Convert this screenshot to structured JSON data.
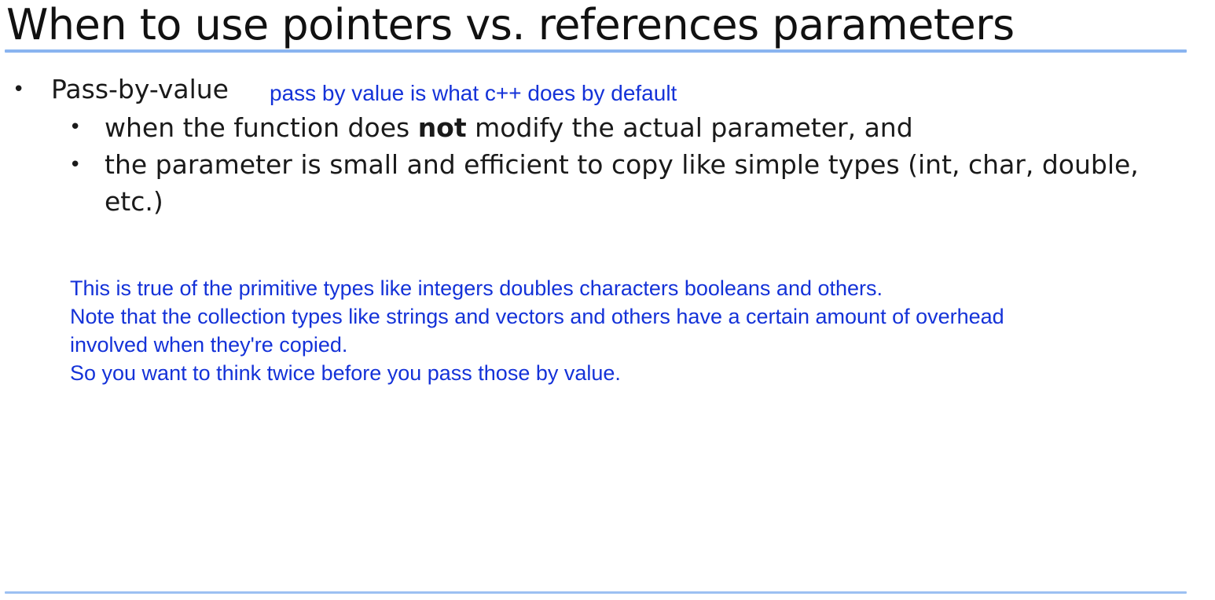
{
  "slide": {
    "title": "When to use pointers vs. references parameters"
  },
  "bullets": {
    "level1": {
      "marker": "•",
      "text": "Pass-by-value"
    },
    "inline_note": "pass by value is what c++ does by default",
    "level2": [
      {
        "marker": "•",
        "before": "when the function does ",
        "emphasis": "not",
        "after": " modify the actual parameter, and"
      },
      {
        "marker": "•",
        "text": "the parameter is small and efficient to copy like simple types (int, char, double, etc.)"
      }
    ]
  },
  "notes": {
    "lines": [
      "This is true of the primitive types like integers doubles characters booleans and others.",
      "Note that the collection types like strings and vectors and others have a certain amount of overhead",
      "involved when they're copied.",
      "So you want to think twice before you pass those by value."
    ]
  },
  "colors": {
    "annotation_text": "#1432d8",
    "rule": "#8ab4f0",
    "body_text": "#1a1a1a"
  }
}
